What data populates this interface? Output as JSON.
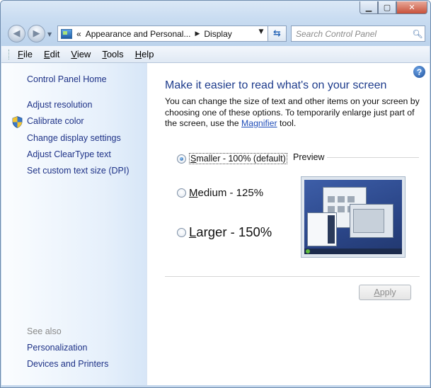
{
  "window": {
    "caption_buttons": [
      "minimize-icon",
      "maximize-icon",
      "close-icon"
    ]
  },
  "nav": {
    "breadcrumb_prefix": "«",
    "breadcrumb": [
      "Appearance and Personal...",
      "Display"
    ],
    "search_placeholder": "Search Control Panel"
  },
  "menu": {
    "items": [
      {
        "label": "File",
        "accel": "F",
        "rest": "ile"
      },
      {
        "label": "Edit",
        "accel": "E",
        "rest": "dit"
      },
      {
        "label": "View",
        "accel": "V",
        "rest": "iew"
      },
      {
        "label": "Tools",
        "accel": "T",
        "rest": "ools"
      },
      {
        "label": "Help",
        "accel": "H",
        "rest": "elp"
      }
    ]
  },
  "sidebar": {
    "home": "Control Panel Home",
    "links": [
      "Adjust resolution",
      "Calibrate color",
      "Change display settings",
      "Adjust ClearType text",
      "Set custom text size (DPI)"
    ],
    "see_also_title": "See also",
    "see_also": [
      "Personalization",
      "Devices and Printers"
    ]
  },
  "main": {
    "help_glyph": "?",
    "heading": "Make it easier to read what's on your screen",
    "desc_before": "You can change the size of text and other items on your screen by choosing one of these options. To temporarily enlarge just part of the screen, use the ",
    "desc_link": "Magnifier",
    "desc_after": " tool.",
    "options": [
      {
        "accel": "S",
        "rest": "maller - 100% (default)",
        "checked": true
      },
      {
        "accel": "M",
        "rest": "edium - 125%",
        "checked": false
      },
      {
        "accel": "L",
        "rest": "arger - 150%",
        "checked": false
      }
    ],
    "preview_label": "Preview",
    "apply_accel": "A",
    "apply_rest": "pply"
  }
}
